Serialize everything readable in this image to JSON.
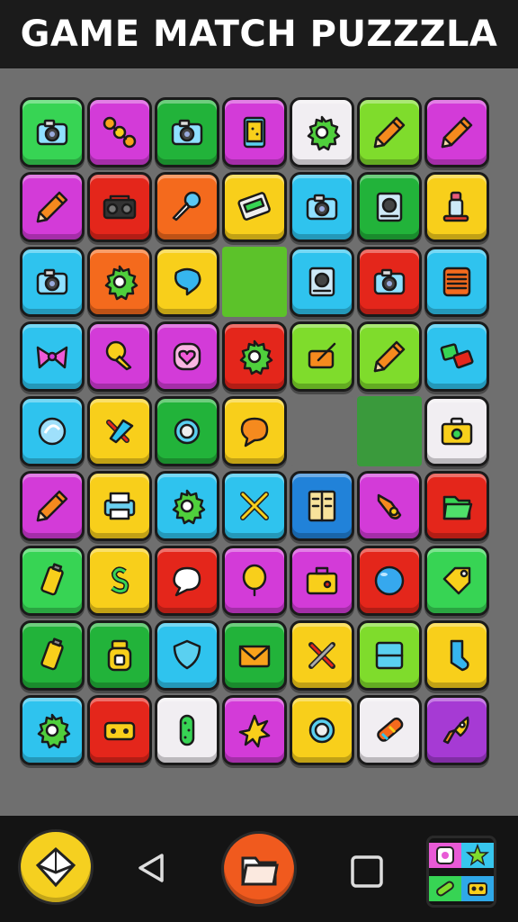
{
  "title": "GAME MATCH PUZZZLA",
  "colors": {
    "green": "#37d454",
    "magenta": "#d33bd8",
    "darkgreen": "#22b33a",
    "white": "#f1eef2",
    "lime": "#7fdc2c",
    "orange": "#f46a1d",
    "red": "#e4261b",
    "yellow": "#f8cf1b",
    "cyan": "#2fc3ee",
    "blue": "#2182d9",
    "purple": "#a63ad4",
    "emptyGreen": "#5cc22a",
    "emptyDark": "#3a9a3c",
    "emptyGray": "#6f6f6f"
  },
  "board": {
    "rows": [
      [
        {
          "color": "green",
          "icon": "camera-icon"
        },
        {
          "color": "magenta",
          "icon": "fidget-spinner-icon"
        },
        {
          "color": "darkgreen",
          "icon": "camera-icon"
        },
        {
          "color": "magenta",
          "icon": "tablet-icon"
        },
        {
          "color": "white",
          "icon": "gear-icon"
        },
        {
          "color": "lime",
          "icon": "pencil-icon"
        },
        {
          "color": "magenta",
          "icon": "pencil-icon"
        }
      ],
      [
        {
          "color": "magenta",
          "icon": "pencil-icon"
        },
        {
          "color": "red",
          "icon": "boombox-icon"
        },
        {
          "color": "orange",
          "icon": "microphone-icon"
        },
        {
          "color": "yellow",
          "icon": "cassette-icon"
        },
        {
          "color": "cyan",
          "icon": "camera-icon"
        },
        {
          "color": "darkgreen",
          "icon": "speaker-icon"
        },
        {
          "color": "yellow",
          "icon": "bottle-icon"
        }
      ],
      [
        {
          "color": "cyan",
          "icon": "camera-icon"
        },
        {
          "color": "orange",
          "icon": "gear-icon"
        },
        {
          "color": "yellow",
          "icon": "heart-bubble-icon"
        },
        {
          "color": "emptyGreen",
          "icon": "",
          "empty": true
        },
        {
          "color": "cyan",
          "icon": "speaker-icon"
        },
        {
          "color": "red",
          "icon": "camera-icon"
        },
        {
          "color": "cyan",
          "icon": "vent-icon"
        }
      ],
      [
        {
          "color": "cyan",
          "icon": "bow-icon"
        },
        {
          "color": "magenta",
          "icon": "pushpin-icon"
        },
        {
          "color": "magenta",
          "icon": "heart-icon"
        },
        {
          "color": "red",
          "icon": "gear-icon"
        },
        {
          "color": "lime",
          "icon": "pen-tablet-icon"
        },
        {
          "color": "lime",
          "icon": "pencil-icon"
        },
        {
          "color": "cyan",
          "icon": "books-icon"
        }
      ],
      [
        {
          "color": "cyan",
          "icon": "badge-icon"
        },
        {
          "color": "yellow",
          "icon": "brush-icon"
        },
        {
          "color": "darkgreen",
          "icon": "ring-icon"
        },
        {
          "color": "yellow",
          "icon": "chat-bubble-icon"
        },
        {
          "color": "emptyGray",
          "icon": "",
          "empty": true
        },
        {
          "color": "emptyDark",
          "icon": "",
          "empty": true
        },
        {
          "color": "white",
          "icon": "briefcase-icon"
        }
      ],
      [
        {
          "color": "magenta",
          "icon": "pencil-icon"
        },
        {
          "color": "yellow",
          "icon": "printer-icon"
        },
        {
          "color": "cyan",
          "icon": "gear-icon"
        },
        {
          "color": "cyan",
          "icon": "crossed-sticks-icon"
        },
        {
          "color": "blue",
          "icon": "notebook-icon"
        },
        {
          "color": "magenta",
          "icon": "glove-icon"
        },
        {
          "color": "red",
          "icon": "folder-icon"
        }
      ],
      [
        {
          "color": "green",
          "icon": "battery-icon"
        },
        {
          "color": "yellow",
          "icon": "dollar-icon"
        },
        {
          "color": "red",
          "icon": "speech-bubble-icon"
        },
        {
          "color": "magenta",
          "icon": "balloon-icon"
        },
        {
          "color": "magenta",
          "icon": "toolbox-icon"
        },
        {
          "color": "red",
          "icon": "ball-icon"
        },
        {
          "color": "green",
          "icon": "tag-icon"
        }
      ],
      [
        {
          "color": "darkgreen",
          "icon": "battery-icon"
        },
        {
          "color": "darkgreen",
          "icon": "jar-icon"
        },
        {
          "color": "cyan",
          "icon": "shield-icon"
        },
        {
          "color": "darkgreen",
          "icon": "envelope-icon"
        },
        {
          "color": "yellow",
          "icon": "tools-icon"
        },
        {
          "color": "lime",
          "icon": "window-icon"
        },
        {
          "color": "yellow",
          "icon": "sock-icon"
        }
      ],
      [
        {
          "color": "cyan",
          "icon": "gear-icon"
        },
        {
          "color": "red",
          "icon": "radio-icon"
        },
        {
          "color": "white",
          "icon": "cactus-icon"
        },
        {
          "color": "magenta",
          "icon": "star-icon"
        },
        {
          "color": "yellow",
          "icon": "ring-icon"
        },
        {
          "color": "white",
          "icon": "crayon-icon"
        },
        {
          "color": "purple",
          "icon": "rocket-icon"
        }
      ]
    ]
  },
  "nav": {
    "left_button": "home-diamond-icon",
    "back_button": "back-triangle-icon",
    "center_button": "folder-icon",
    "recent_button": "recent-square-icon",
    "apps_button": "apps-grid-icon"
  }
}
